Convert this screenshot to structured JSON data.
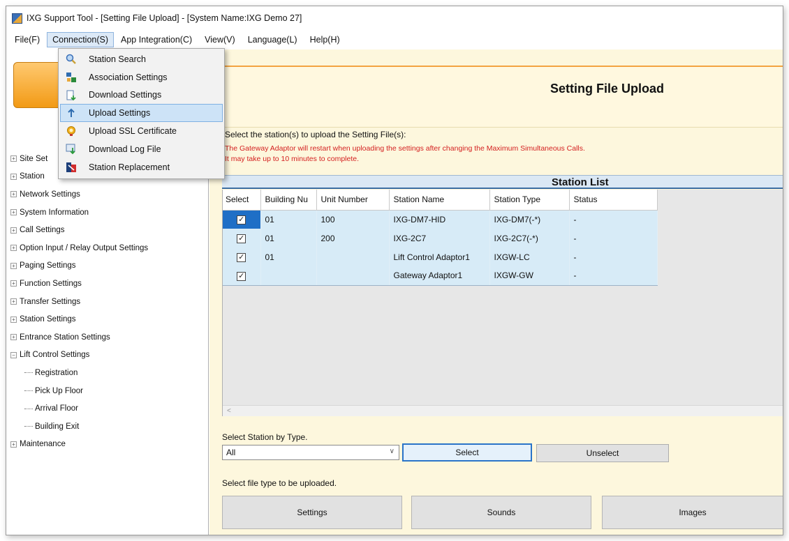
{
  "window": {
    "title": "IXG Support Tool - [Setting File Upload] - [System Name:IXG Demo 27]"
  },
  "menubar": [
    {
      "label": "File(F)"
    },
    {
      "label": "Connection(S)"
    },
    {
      "label": "App Integration(C)"
    },
    {
      "label": "View(V)"
    },
    {
      "label": "Language(L)"
    },
    {
      "label": "Help(H)"
    }
  ],
  "connection_menu": {
    "items": [
      {
        "label": "Station Search",
        "icon": "magnifier-icon"
      },
      {
        "label": "Association Settings",
        "icon": "association-icon"
      },
      {
        "label": "Download Settings",
        "icon": "download-settings-icon"
      },
      {
        "label": "Upload Settings",
        "icon": "upload-arrow-icon",
        "highlighted": true
      },
      {
        "label": "Upload SSL Certificate",
        "icon": "certificate-icon"
      },
      {
        "label": "Download Log File",
        "icon": "download-log-icon"
      },
      {
        "label": "Station Replacement",
        "icon": "replacement-icon"
      }
    ]
  },
  "tree": {
    "items": [
      {
        "label": "Site Set",
        "expander": "+"
      },
      {
        "label": "Station",
        "expander": "+"
      },
      {
        "label": "Network Settings",
        "expander": "+"
      },
      {
        "label": "System Information",
        "expander": "+"
      },
      {
        "label": "Call Settings",
        "expander": "+"
      },
      {
        "label": "Option Input / Relay Output Settings",
        "expander": "+"
      },
      {
        "label": "Paging Settings",
        "expander": "+"
      },
      {
        "label": "Function Settings",
        "expander": "+"
      },
      {
        "label": "Transfer Settings",
        "expander": "+"
      },
      {
        "label": "Station Settings",
        "expander": "+"
      },
      {
        "label": "Entrance Station Settings",
        "expander": "+"
      },
      {
        "label": "Lift Control Settings",
        "expander": "−"
      },
      {
        "label": "Registration",
        "child": true
      },
      {
        "label": "Pick Up Floor",
        "child": true
      },
      {
        "label": "Arrival Floor",
        "child": true
      },
      {
        "label": "Building Exit",
        "child": true
      },
      {
        "label": "Maintenance",
        "expander": "+"
      }
    ]
  },
  "page": {
    "title": "Setting File Upload",
    "instruction": "Select the station(s) to upload the Setting File(s):",
    "warning_line1": "The Gateway Adaptor will restart when uploading the settings after changing the Maximum Simultaneous Calls.",
    "warning_line2": "It may take up to 10 minutes to complete.",
    "station_list_title": "Station List"
  },
  "table": {
    "headers": [
      "Select",
      "Building Nu",
      "Unit Number",
      "Station Name",
      "Station Type",
      "Status"
    ],
    "rows": [
      {
        "checked": "✓",
        "building": "01",
        "unit": "100",
        "name": "IXG-DM7-HID",
        "type": "IXG-DM7(-*)",
        "status": "-"
      },
      {
        "checked": "✓",
        "building": "01",
        "unit": "200",
        "name": "IXG-2C7",
        "type": "IXG-2C7(-*)",
        "status": "-"
      },
      {
        "checked": "✓",
        "building": "01",
        "unit": "",
        "name": "Lift Control Adaptor1",
        "type": "IXGW-LC",
        "status": "-"
      },
      {
        "checked": "✓",
        "building": "",
        "unit": "",
        "name": "Gateway Adaptor1",
        "type": "IXGW-GW",
        "status": "-"
      }
    ],
    "scroll_left_glyph": "<"
  },
  "select_by_type": {
    "label": "Select Station by Type.",
    "value": "All",
    "select_label": "Select",
    "unselect_label": "Unselect"
  },
  "file_type": {
    "label": "Select file type to be uploaded.",
    "settings_label": "Settings",
    "sounds_label": "Sounds",
    "images_label": "Images"
  }
}
